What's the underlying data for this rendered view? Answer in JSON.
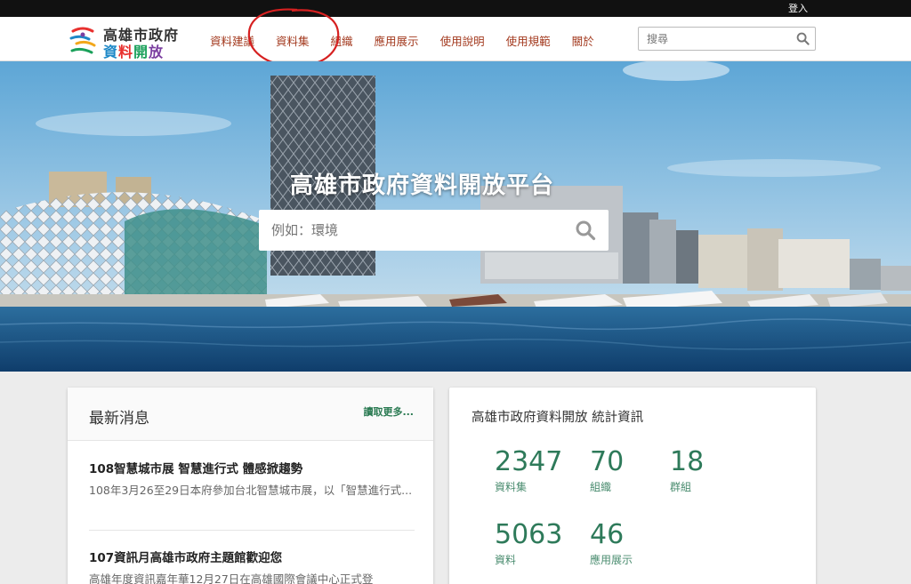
{
  "topbar": {
    "login": "登入"
  },
  "header": {
    "logo_line1": "高雄市政府",
    "logo_line2_chars": [
      {
        "ch": "資",
        "color": "#1e88c7"
      },
      {
        "ch": "料",
        "color": "#e8312f"
      },
      {
        "ch": "開",
        "color": "#1aa05a"
      },
      {
        "ch": "放",
        "color": "#7b3fa0"
      }
    ],
    "nav": [
      "資料建議",
      "資料集",
      "組織",
      "應用展示",
      "使用說明",
      "使用規範",
      "關於"
    ],
    "search_placeholder": "搜尋"
  },
  "hero": {
    "title": "高雄市政府資料開放平台",
    "search_placeholder": "例如：環境"
  },
  "news": {
    "title": "最新消息",
    "more": "讀取更多...",
    "items": [
      {
        "title": "108智慧城市展 智慧進行式 體感掀趨勢",
        "desc": "108年3月26至29日本府參加台北智慧城市展，以「智慧進行式..."
      },
      {
        "title": "107資訊月高雄市政府主題館歡迎您",
        "desc": "高雄年度資訊嘉年華12月27日在高雄國際會議中心正式登"
      }
    ]
  },
  "stats": {
    "title": "高雄市政府資料開放 統計資訊",
    "items": [
      {
        "value": "2347",
        "label": "資料集"
      },
      {
        "value": "70",
        "label": "組織"
      },
      {
        "value": "18",
        "label": "群組"
      },
      {
        "value": "5063",
        "label": "資料"
      },
      {
        "value": "46",
        "label": "應用展示"
      }
    ]
  },
  "colors": {
    "nav": "#a33a1f",
    "stat": "#2e7a5a",
    "more": "#2a7a52",
    "annotation": "#d62020"
  }
}
